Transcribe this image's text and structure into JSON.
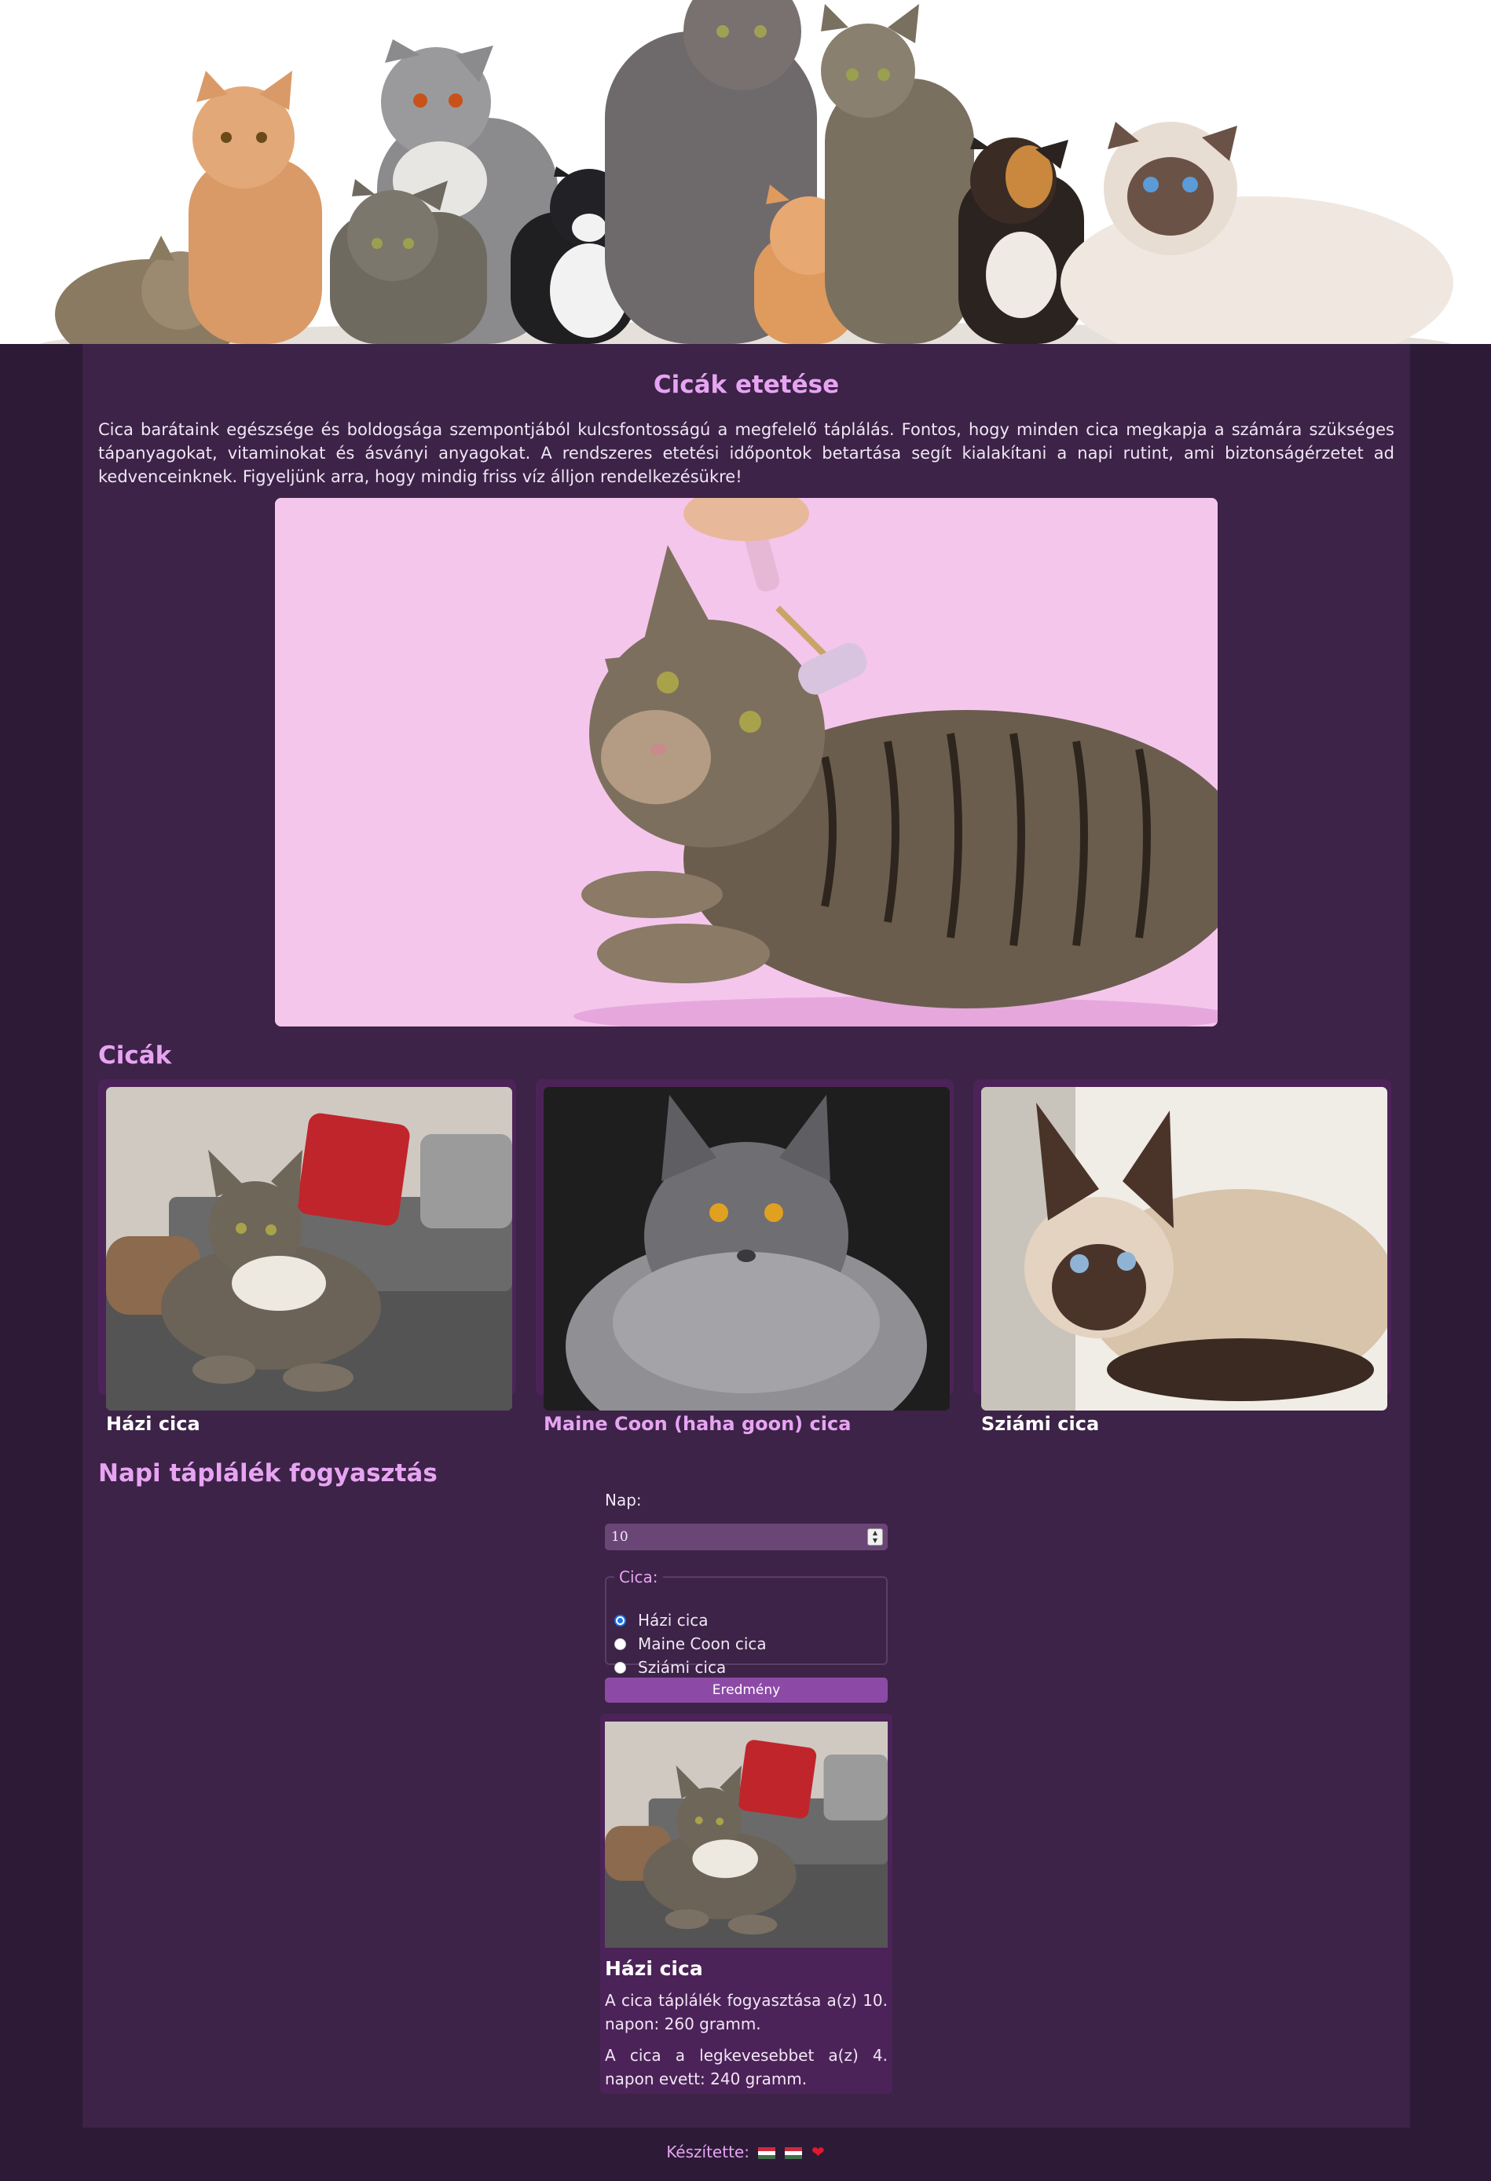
{
  "page": {
    "title": "Cicák etetése",
    "intro": "Cica barátaink egészsége és boldogsága szempontjából kulcsfontosságú a megfelelő táplálás. Fontos, hogy minden cica megkapja a számára szükséges tápanyagokat, vitaminokat és ásványi anyagokat. A rendszeres etetési időpontok betartása segít kialakítani a napi rutint, ami biztonságérzetet ad kedvenceinknek. Figyeljünk arra, hogy mindig friss víz álljon rendelkezésükre!"
  },
  "cats_section": {
    "title": "Cicák",
    "cards": [
      {
        "name": "Házi cica"
      },
      {
        "name": "Maine Coon (haha goon) cica"
      },
      {
        "name": "Sziámi cica"
      }
    ]
  },
  "consumption": {
    "title": "Napi táplálék fogyasztás",
    "day_label": "Nap:",
    "day_value": "10",
    "cat_legend": "Cica:",
    "options": [
      {
        "label": "Házi cica",
        "selected": true
      },
      {
        "label": "Maine Coon cica",
        "selected": false
      },
      {
        "label": "Sziámi cica",
        "selected": false
      }
    ],
    "button_label": "Eredmény",
    "result": {
      "name": "Házi cica",
      "line1": "A cica táplálék fogyasztása a(z) 10. napon: 260 gramm.",
      "line2": "A cica a legkevesebbet a(z) 4. napon evett: 240 gramm."
    }
  },
  "footer": {
    "text": "Készítette:"
  },
  "colors": {
    "background": "#2c1a37",
    "panel": "#3c2347",
    "card": "#4c2358",
    "accent": "#e7a4f2",
    "button": "#8c4aa6"
  }
}
